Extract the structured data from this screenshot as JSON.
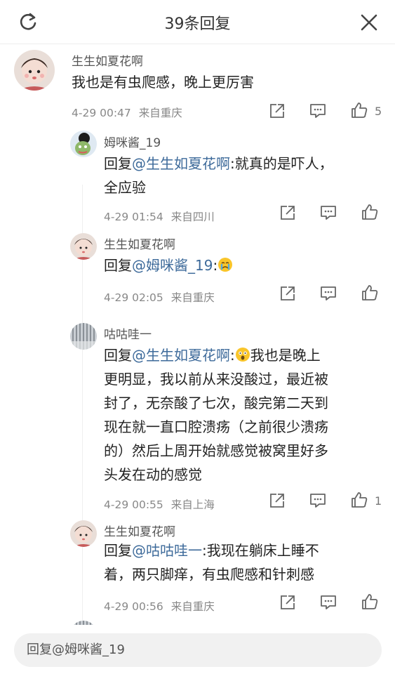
{
  "header": {
    "title": "39条回复",
    "refresh_icon": "refresh-icon",
    "close_icon": "close-icon"
  },
  "top_comment": {
    "username": "生生如夏花啊",
    "text": "我也是有虫爬感，晚上更厉害",
    "time": "4-29 00:47",
    "location": "来自重庆",
    "likes": "5"
  },
  "replies": [
    {
      "username": "姆咪酱_19",
      "prefix": "回复",
      "mention": "@生生如夏花啊",
      "line1_rest": ":就真的是吓人，",
      "line2": "全应验",
      "time": "4-29 01:54",
      "location": "来自四川"
    },
    {
      "username": "生生如夏花啊",
      "prefix": "回复",
      "mention": "@姆咪酱_19",
      "line1_rest": ":",
      "emoji": "crying-face-emoji",
      "time": "4-29 02:05",
      "location": "来自重庆"
    },
    {
      "username": "咕咕哇一",
      "prefix": "回复",
      "mention": "@生生如夏花啊",
      "line1_rest": ":",
      "emoji": "astonished-face-emoji",
      "line1_after": "我也是晚上",
      "lines": [
        "更明显，我以前从来没酸过，最近被",
        "封了，无奈酸了七次，酸完第二天到",
        "现在就一直口腔溃疡（之前很少溃疡",
        "的）然后上周开始就感觉被窝里好多",
        "头发在动的感觉"
      ],
      "time": "4-29 00:55",
      "location": "来自上海",
      "likes": "1"
    },
    {
      "username": "生生如夏花啊",
      "prefix": "回复",
      "mention": "@咕咕哇一",
      "line1_rest": ":我现在躺床上睡不",
      "line2": "着，两只脚痒，有虫爬感和针刺感",
      "time": "4-29 00:56",
      "location": "来自重庆"
    }
  ],
  "footer": {
    "placeholder": "回复@姆咪酱_19"
  }
}
